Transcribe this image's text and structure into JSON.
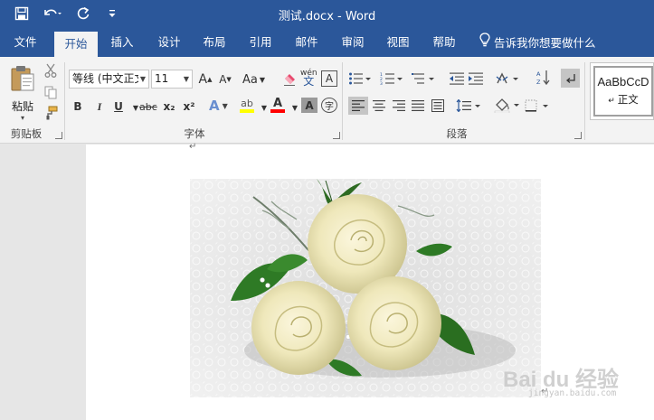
{
  "titlebar": {
    "title": "测试.docx  -  Word",
    "qat": [
      "save-icon",
      "undo-icon",
      "redo-icon",
      "customize-qat-icon"
    ]
  },
  "tabs": [
    {
      "label": "文件"
    },
    {
      "label": "开始",
      "active": true
    },
    {
      "label": "插入"
    },
    {
      "label": "设计"
    },
    {
      "label": "布局"
    },
    {
      "label": "引用"
    },
    {
      "label": "邮件"
    },
    {
      "label": "审阅"
    },
    {
      "label": "视图"
    },
    {
      "label": "帮助"
    }
  ],
  "tellme": {
    "label": "告诉我你想要做什么"
  },
  "clipboard": {
    "paste_label": "粘贴",
    "group_label": "剪贴板"
  },
  "font": {
    "name": "等线 (中文正文",
    "size": "11",
    "group_label": "字体",
    "aa_label": "Aa",
    "pinyin_label": "wén",
    "bold_label": "B",
    "italic_label": "I",
    "underline_label": "U",
    "strike_label": "abc",
    "sub_label": "x₂",
    "sup_label": "x²",
    "grow_label": "A",
    "shrink_label": "A",
    "border_label": "A",
    "shade_label": "A",
    "enclose_label": "字",
    "highlight_color": "#ffff00",
    "font_color": "#ff0000"
  },
  "paragraph": {
    "group_label": "段落"
  },
  "styles": {
    "sample": "AaBbCcD",
    "name": "正文"
  },
  "document": {
    "paragraph_mark": "↵"
  },
  "watermark": {
    "logo": "Bai du 经验",
    "sub": "jingyan.baidu.com"
  },
  "colors": {
    "accent": "#2b579a",
    "ribbon_bg": "#f3f3f3",
    "canvas": "#e6e6e6"
  }
}
